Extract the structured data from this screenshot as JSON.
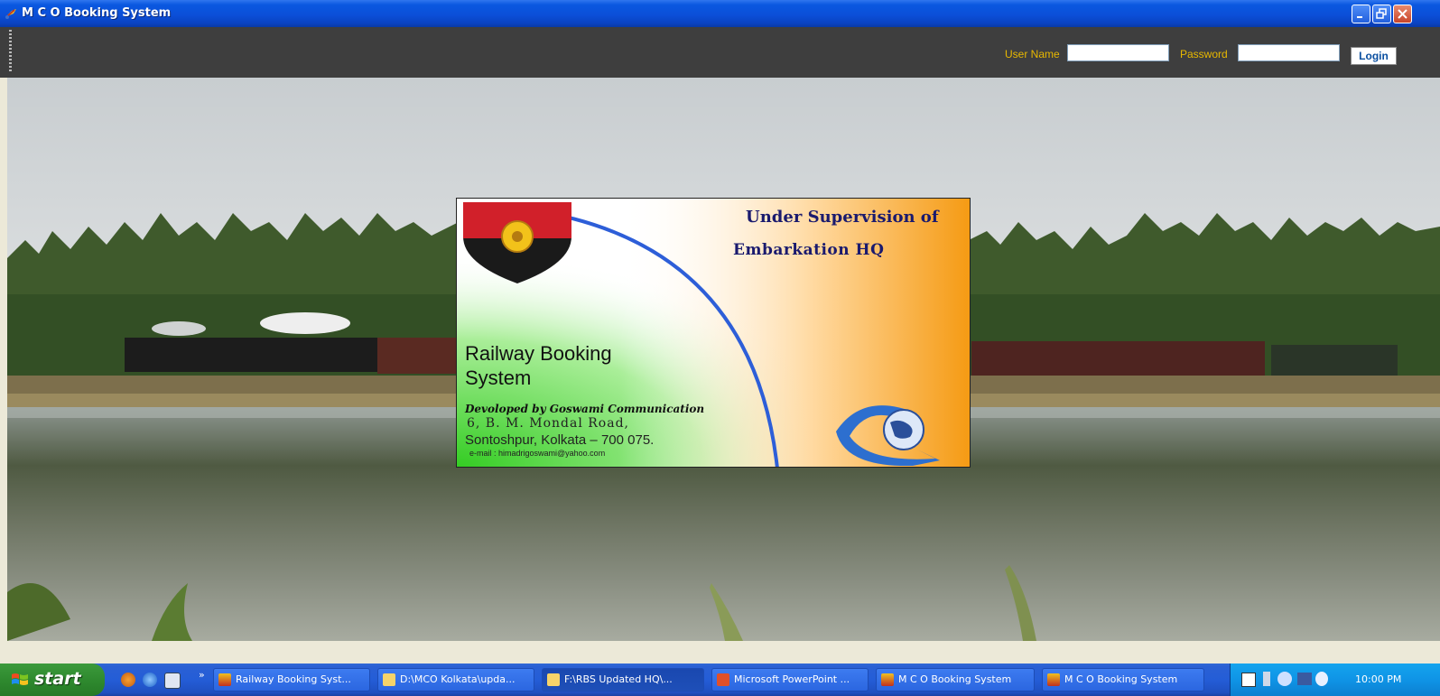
{
  "window": {
    "title": "M C O Booking System"
  },
  "login": {
    "username_label": "User Name",
    "username_value": "",
    "password_label": "Password",
    "password_value": "",
    "login_button": "Login"
  },
  "splash": {
    "supervision_line1": "Under Supervision of",
    "supervision_line2": "Embarkation HQ",
    "app_title_line1": "Railway Booking",
    "app_title_line2": "System",
    "developer": "Devoloped by Goswami Communication",
    "address_line1": "6, B. M. Mondal Road,",
    "address_line2": "Sontoshpur, Kolkata – 700 075.",
    "email": "e-mail : himadrigoswami@yahoo.com"
  },
  "taskbar": {
    "start_label": "start",
    "overflow": "»",
    "tasks": [
      {
        "label": "Railway Booking Syst...",
        "icon": "app-icon"
      },
      {
        "label": "D:\\MCO Kolkata\\upda...",
        "icon": "folder-icon"
      },
      {
        "label": "F:\\RBS Updated HQ\\...",
        "icon": "folder-icon"
      },
      {
        "label": "Microsoft PowerPoint ...",
        "icon": "powerpoint-icon"
      },
      {
        "label": "M C O Booking System",
        "icon": "app-icon"
      },
      {
        "label": "M C O Booking System",
        "icon": "app-icon"
      }
    ],
    "clock": "10:00 PM"
  },
  "colors": {
    "titlebar": "#0a58e0",
    "header_bg": "#3e3e3e",
    "label_yellow": "#e8b800",
    "taskbar": "#245dd7",
    "start_green": "#2f8a2f",
    "tray": "#0f94e6"
  }
}
